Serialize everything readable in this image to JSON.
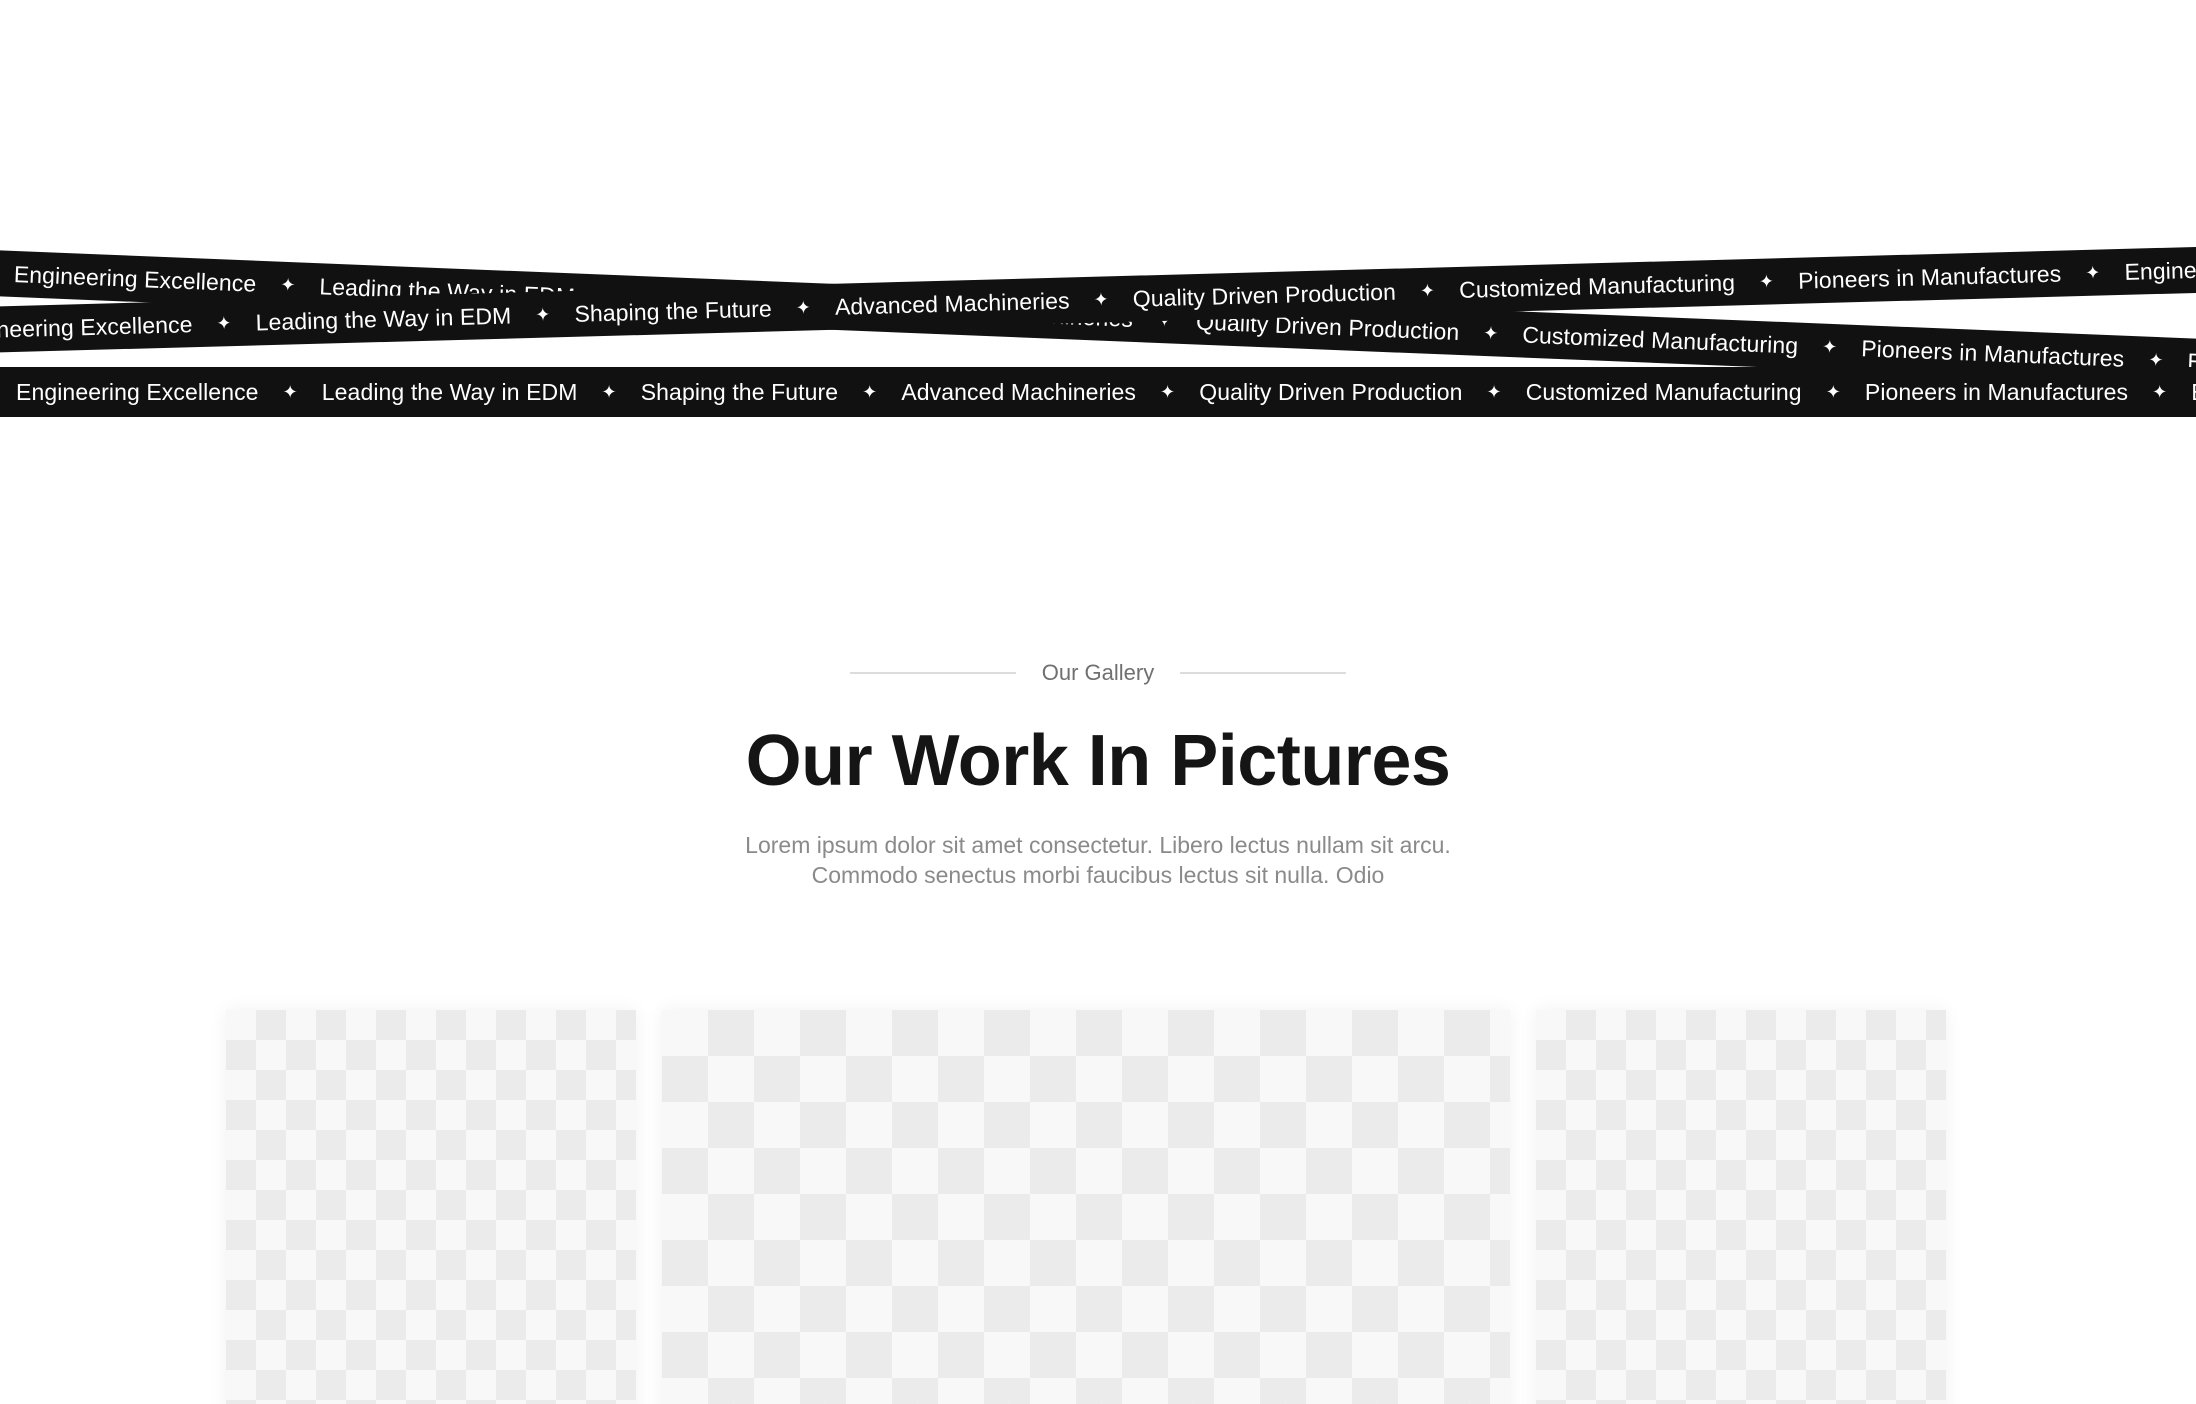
{
  "marquee": {
    "items": [
      "Engineering Excellence",
      "Leading the Way in EDM",
      "Shaping the Future",
      "Advanced Machineries",
      "Quality Driven Production",
      "Customized Manufacturing",
      "Pioneers in Manufactures"
    ],
    "separator": "✦",
    "background_color": "#111111",
    "text_color": "#ffffff"
  },
  "gallery": {
    "eyebrow": "Our Gallery",
    "title": "Our Work In Pictures",
    "description": "Lorem ipsum dolor sit amet consectetur. Libero lectus nullam sit arcu. Commodo senectus morbi faucibus lectus sit nulla. Odio",
    "images": [
      {
        "alt": "Gallery image 1"
      },
      {
        "alt": "Gallery image 2"
      },
      {
        "alt": "Gallery image 3"
      }
    ]
  }
}
